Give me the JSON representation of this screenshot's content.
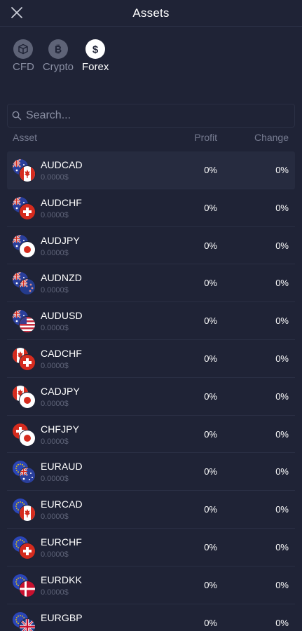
{
  "header": {
    "title": "Assets",
    "close_icon": "close-icon"
  },
  "tabs": [
    {
      "label": "CFD",
      "icon": "cube-icon",
      "active": false
    },
    {
      "label": "Crypto",
      "icon": "bitcoin-icon",
      "active": false
    },
    {
      "label": "Forex",
      "icon": "dollar-icon",
      "active": true
    }
  ],
  "search": {
    "placeholder": "Search...",
    "value": ""
  },
  "columns": {
    "asset": "Asset",
    "profit": "Profit",
    "change": "Change"
  },
  "rows": [
    {
      "symbol": "AUDCAD",
      "price": "0.0000$",
      "profit": "0%",
      "change": "0%",
      "flags": [
        "au",
        "ca"
      ],
      "selected": true
    },
    {
      "symbol": "AUDCHF",
      "price": "0.0000$",
      "profit": "0%",
      "change": "0%",
      "flags": [
        "au",
        "ch"
      ]
    },
    {
      "symbol": "AUDJPY",
      "price": "0.0000$",
      "profit": "0%",
      "change": "0%",
      "flags": [
        "au",
        "jp"
      ]
    },
    {
      "symbol": "AUDNZD",
      "price": "0.0000$",
      "profit": "0%",
      "change": "0%",
      "flags": [
        "au",
        "nz"
      ]
    },
    {
      "symbol": "AUDUSD",
      "price": "0.0000$",
      "profit": "0%",
      "change": "0%",
      "flags": [
        "au",
        "us"
      ]
    },
    {
      "symbol": "CADCHF",
      "price": "0.0000$",
      "profit": "0%",
      "change": "0%",
      "flags": [
        "ca",
        "ch"
      ]
    },
    {
      "symbol": "CADJPY",
      "price": "0.0000$",
      "profit": "0%",
      "change": "0%",
      "flags": [
        "ca",
        "jp"
      ]
    },
    {
      "symbol": "CHFJPY",
      "price": "0.0000$",
      "profit": "0%",
      "change": "0%",
      "flags": [
        "ch",
        "jp"
      ]
    },
    {
      "symbol": "EURAUD",
      "price": "0.0000$",
      "profit": "0%",
      "change": "0%",
      "flags": [
        "eu",
        "au"
      ]
    },
    {
      "symbol": "EURCAD",
      "price": "0.0000$",
      "profit": "0%",
      "change": "0%",
      "flags": [
        "eu",
        "ca"
      ]
    },
    {
      "symbol": "EURCHF",
      "price": "0.0000$",
      "profit": "0%",
      "change": "0%",
      "flags": [
        "eu",
        "ch"
      ]
    },
    {
      "symbol": "EURDKK",
      "price": "0.0000$",
      "profit": "0%",
      "change": "0%",
      "flags": [
        "eu",
        "dk"
      ]
    },
    {
      "symbol": "EURGBP",
      "price": "",
      "profit": "0%",
      "change": "0%",
      "flags": [
        "eu",
        "gb"
      ]
    }
  ],
  "colors": {
    "background": "#1f2336",
    "divider": "#2a2f44",
    "muted": "#767b90",
    "selected_row": "#262b3f"
  }
}
